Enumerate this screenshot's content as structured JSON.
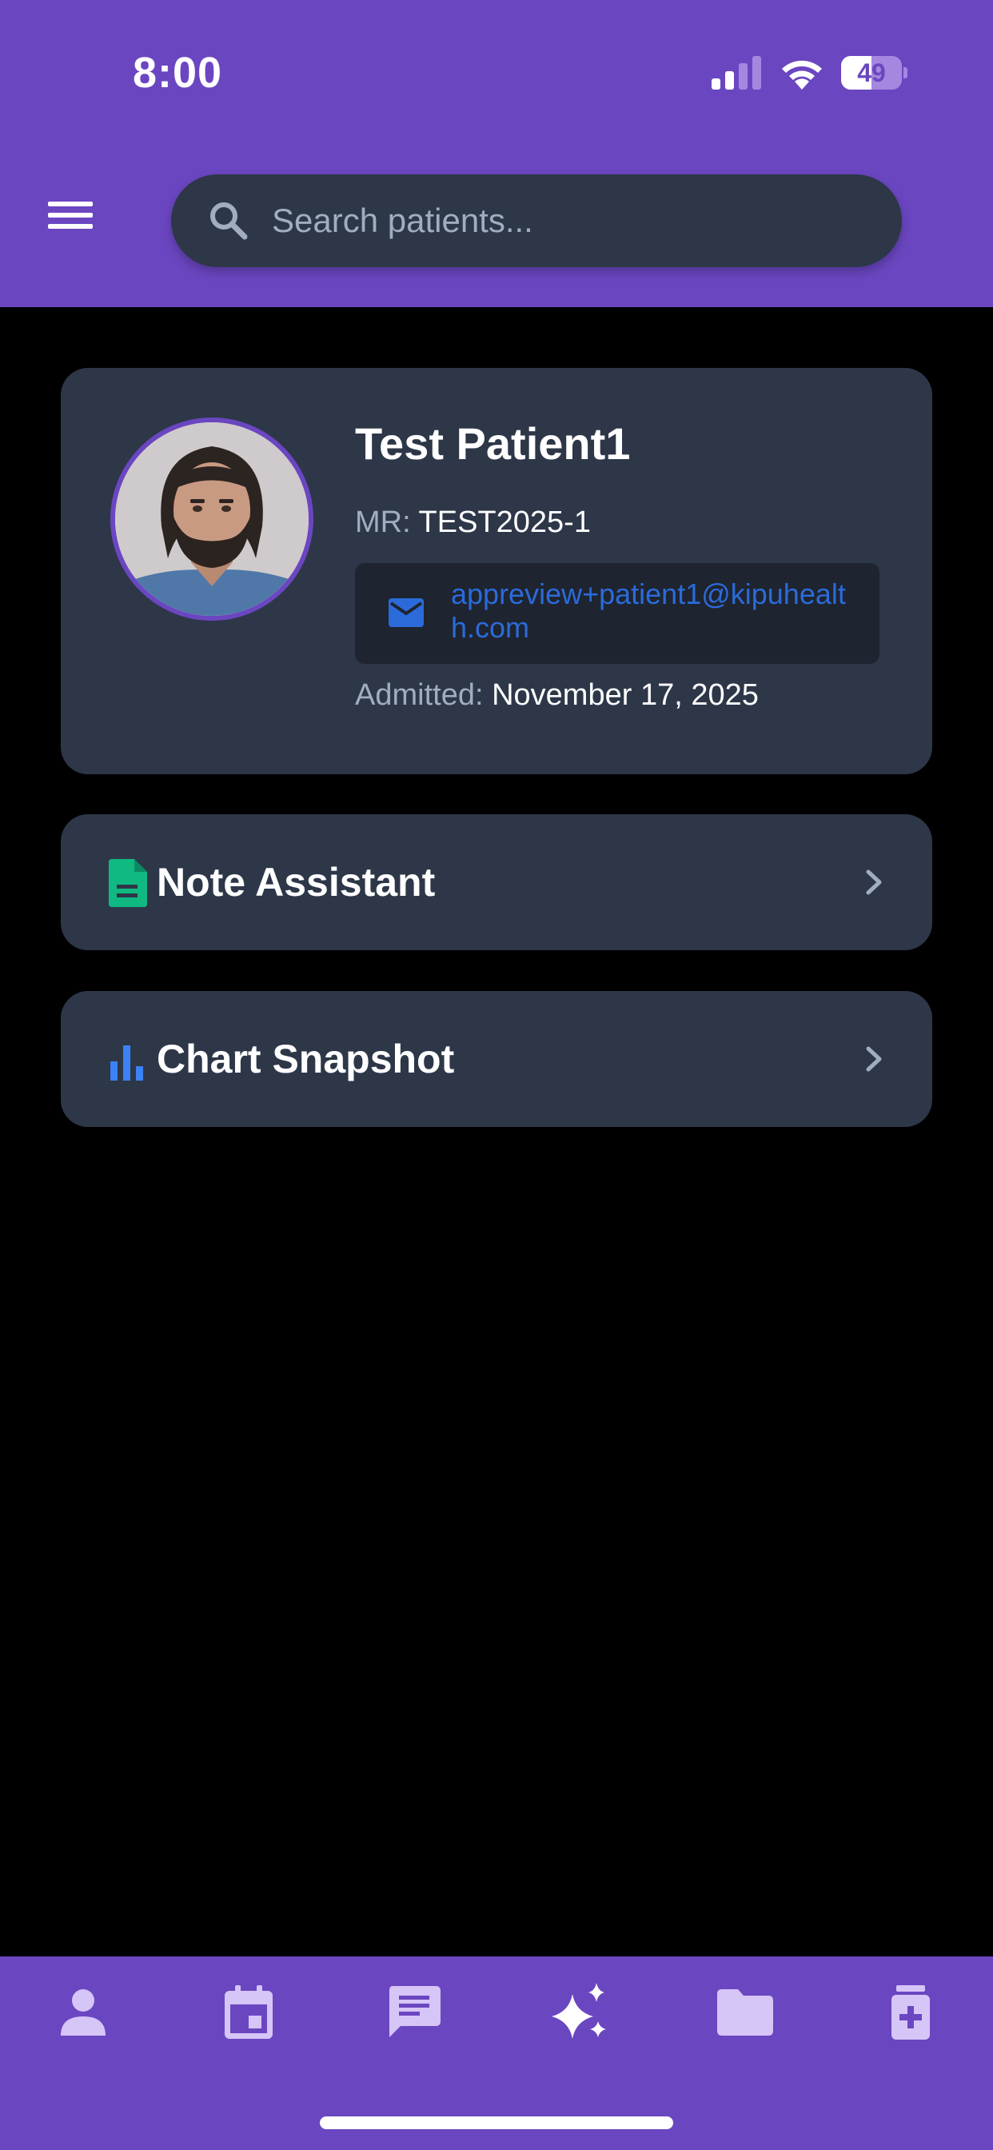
{
  "status_bar": {
    "time": "8:00",
    "battery": "49",
    "icons": [
      "cellular-signal-icon",
      "wifi-icon",
      "battery-icon"
    ]
  },
  "header": {
    "menu_icon": "hamburger-menu-icon",
    "search": {
      "placeholder": "Search patients...",
      "value": "",
      "icon": "search-icon"
    }
  },
  "patient": {
    "name": "Test Patient1",
    "mr_label": "MR:",
    "mr_value": "TEST2025-1",
    "email": "appreview+patient1@kipuhealth.com",
    "admitted_label": "Admitted:",
    "admitted_value": "November 17, 2025",
    "avatar": "patient-photo"
  },
  "actions": [
    {
      "label": "Note Assistant",
      "icon": "document-icon",
      "icon_color": "#10b981"
    },
    {
      "label": "Chart Snapshot",
      "icon": "bar-chart-icon",
      "icon_color": "#3b82f6"
    }
  ],
  "bottom_nav": {
    "items": [
      "person-icon",
      "calendar-icon",
      "chat-icon",
      "sparkles-icon",
      "folder-icon",
      "medication-icon"
    ],
    "active_index": 3
  },
  "colors": {
    "brand": "#6b46c1",
    "card": "#2d3748",
    "background": "#000000",
    "link": "#2b6bd9",
    "muted": "#a0aec0",
    "nav_icon": "#d6c5f7"
  }
}
